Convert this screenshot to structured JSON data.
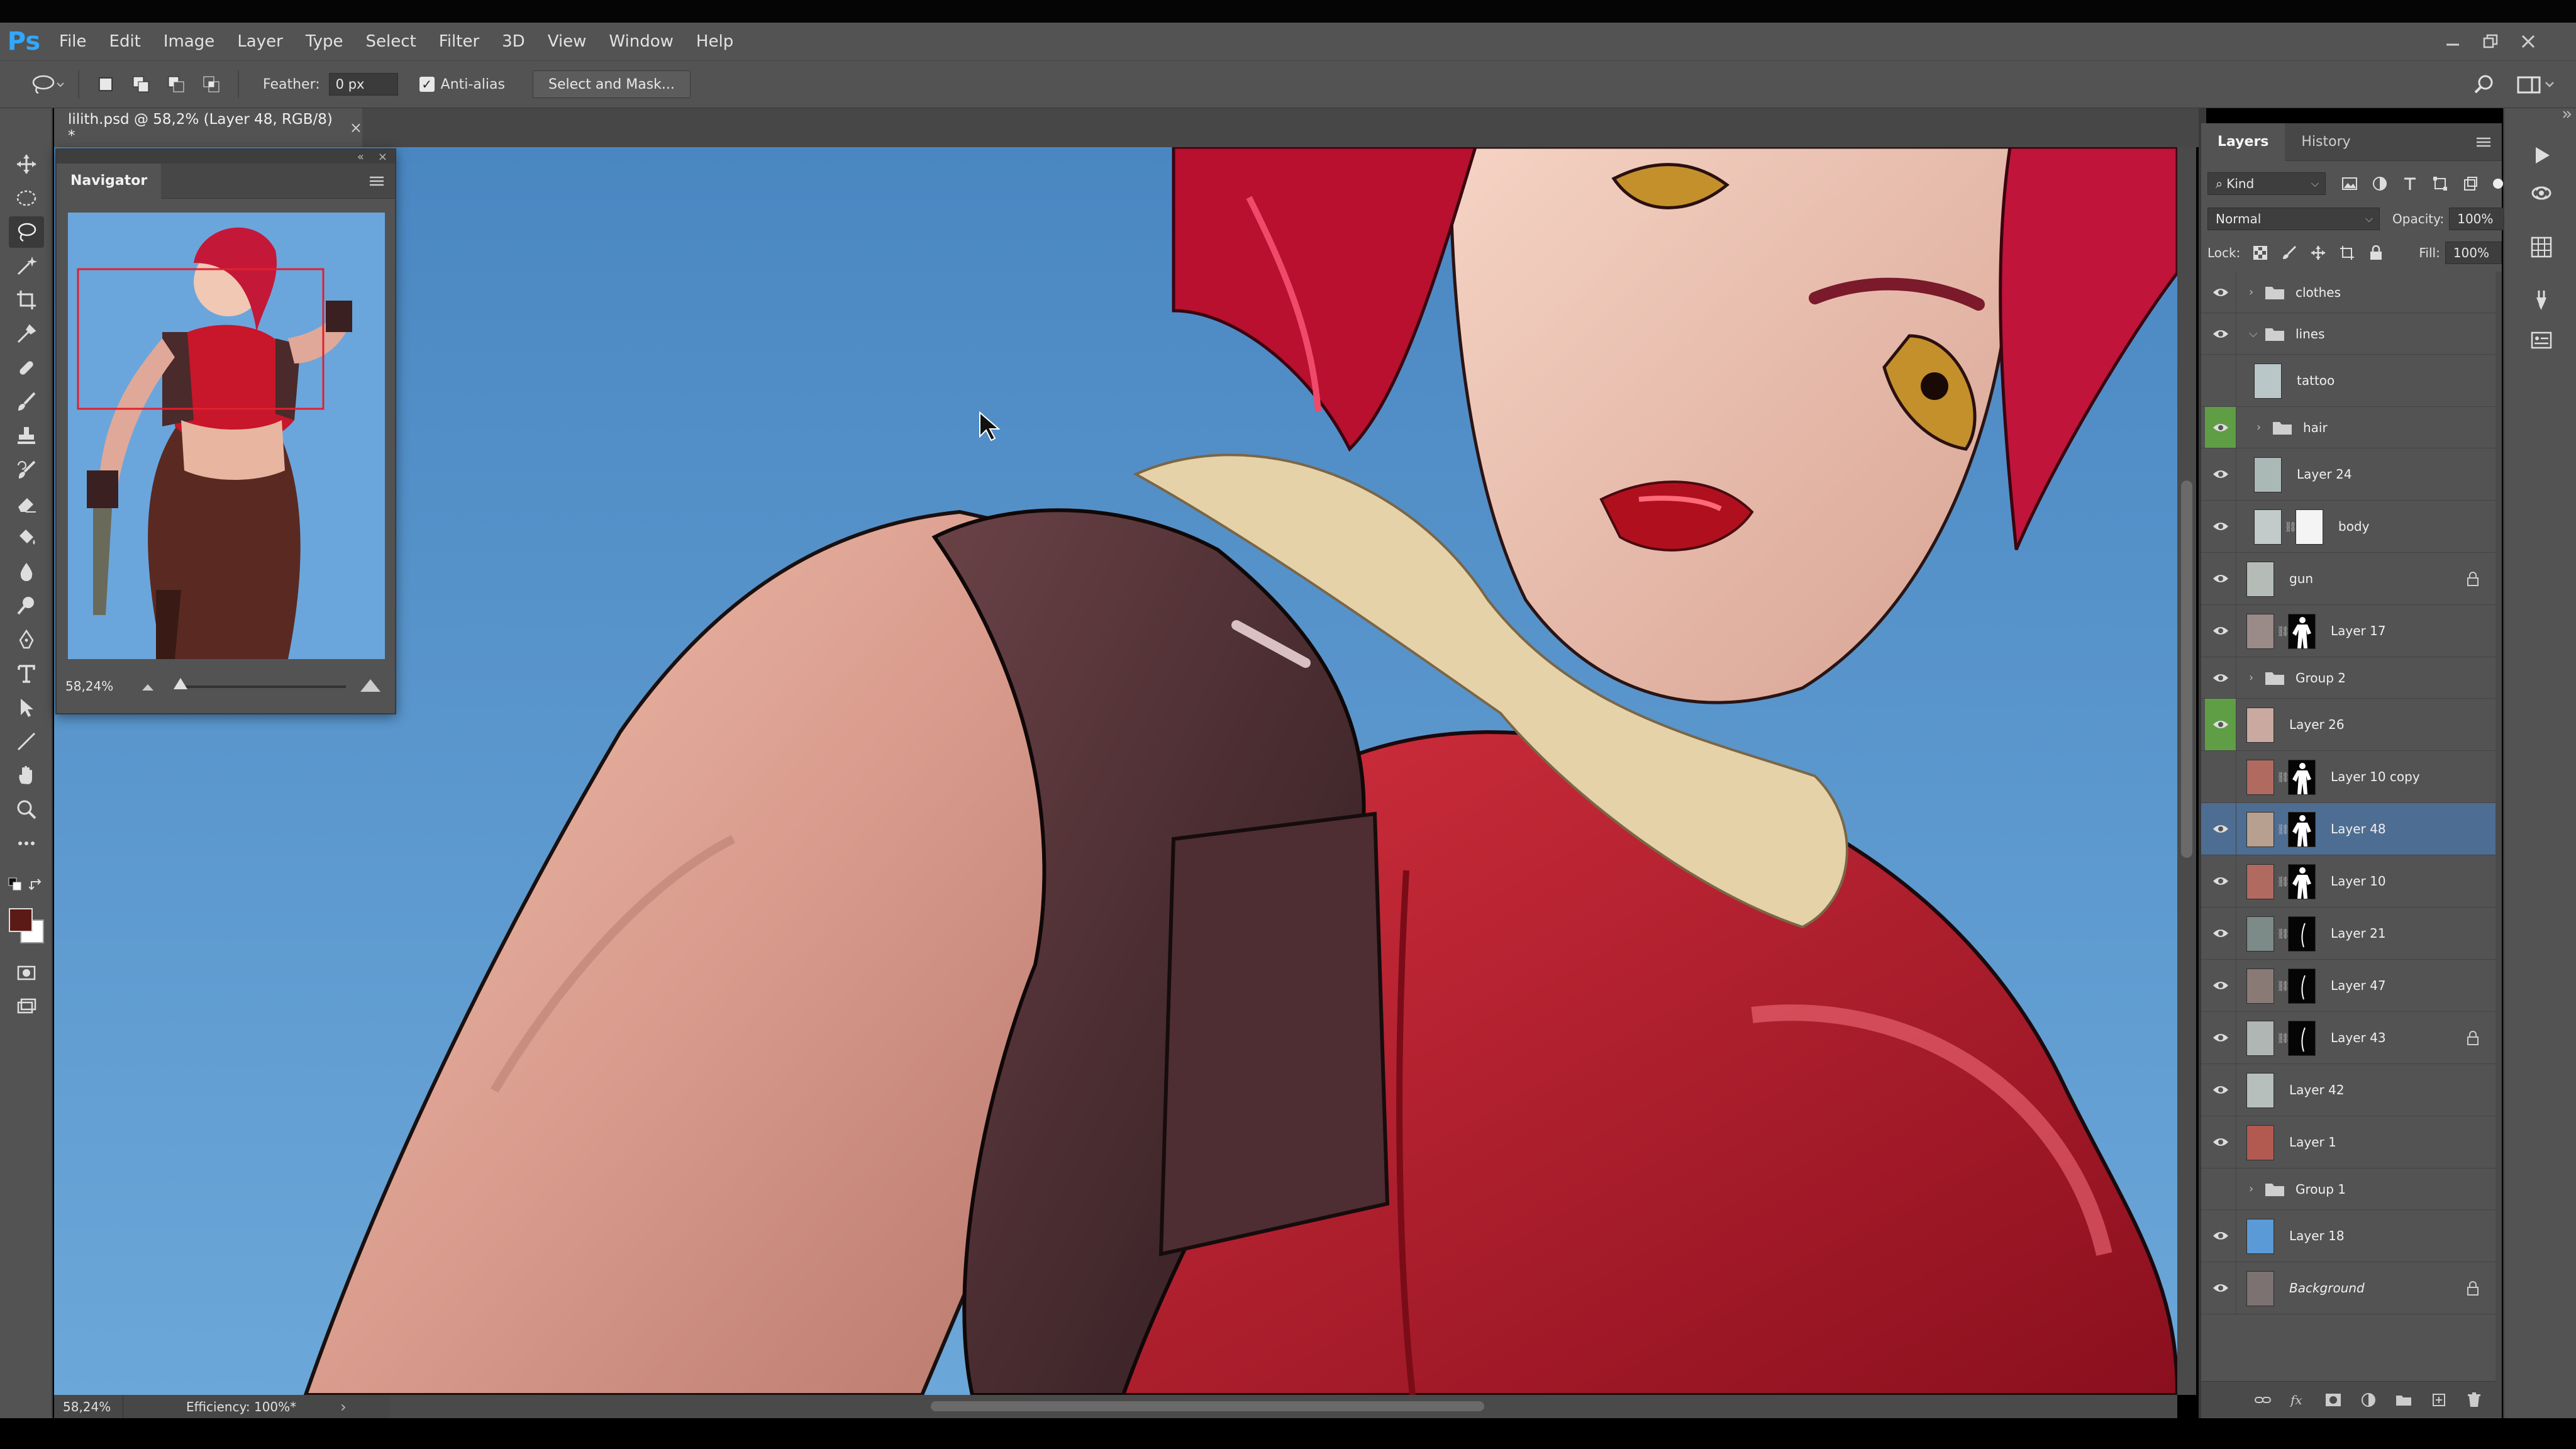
{
  "app": {
    "logo": "Ps"
  },
  "menu": [
    "File",
    "Edit",
    "Image",
    "Layer",
    "Type",
    "Select",
    "Filter",
    "3D",
    "View",
    "Window",
    "Help"
  ],
  "options": {
    "feather_label": "Feather:",
    "feather_value": "0 px",
    "antialias_label": "Anti-alias",
    "antialias_checked": "✓",
    "select_mask_label": "Select and Mask..."
  },
  "document": {
    "tab_title": "lilith.psd @ 58,2% (Layer 48, RGB/8) *",
    "close": "×"
  },
  "status": {
    "zoom": "58,24%",
    "efficiency": "Efficiency: 100%*",
    "arrow": "›"
  },
  "navigator": {
    "title": "Navigator",
    "zoom": "58,24%",
    "collapse": "«",
    "close": "×"
  },
  "layers_panel": {
    "tabs": [
      "Layers",
      "History"
    ],
    "filter_kind": "Kind",
    "filter_icon": "⌕",
    "blend_mode": "Normal",
    "opacity_label": "Opacity:",
    "opacity_value": "100%",
    "lock_label": "Lock:",
    "fill_label": "Fill:",
    "fill_value": "100%",
    "layers": [
      {
        "name": "clothes",
        "type": "group",
        "expanded": false,
        "visible": true
      },
      {
        "name": "lines",
        "type": "group",
        "expanded": true,
        "visible": true
      },
      {
        "name": "tattoo",
        "type": "layer",
        "visible": false,
        "indent": true
      },
      {
        "name": "hair",
        "type": "group",
        "expanded": false,
        "visible": true,
        "indent": true,
        "eye_highlight": true
      },
      {
        "name": "Layer 24",
        "type": "layer",
        "visible": true,
        "indent": true
      },
      {
        "name": "body",
        "type": "layer",
        "visible": true,
        "indent": true,
        "mask": "white"
      },
      {
        "name": "gun",
        "type": "layer",
        "visible": true,
        "locked": true
      },
      {
        "name": "Layer 17",
        "type": "layer",
        "visible": true,
        "mask": "figure"
      },
      {
        "name": "Group 2",
        "type": "group",
        "expanded": false,
        "visible": true
      },
      {
        "name": "Layer 26",
        "type": "layer",
        "visible": true,
        "eye_highlight": true
      },
      {
        "name": "Layer 10 copy",
        "type": "layer",
        "visible": false,
        "mask": "figure"
      },
      {
        "name": "Layer 48",
        "type": "layer",
        "visible": true,
        "mask": "figure",
        "selected": true
      },
      {
        "name": "Layer 10",
        "type": "layer",
        "visible": true,
        "mask": "figure"
      },
      {
        "name": "Layer 21",
        "type": "layer",
        "visible": true,
        "mask": "black"
      },
      {
        "name": "Layer 47",
        "type": "layer",
        "visible": true,
        "mask": "black"
      },
      {
        "name": "Layer 43",
        "type": "layer",
        "visible": true,
        "mask": "black",
        "locked": true
      },
      {
        "name": "Layer 42",
        "type": "layer",
        "visible": true
      },
      {
        "name": "Layer 1",
        "type": "layer",
        "visible": true
      },
      {
        "name": "Group 1",
        "type": "group",
        "expanded": false,
        "visible": false
      },
      {
        "name": "Layer 18",
        "type": "layer",
        "visible": true
      },
      {
        "name": "Background",
        "type": "layer",
        "visible": true,
        "locked": true,
        "italic": true
      }
    ]
  },
  "colors": {
    "foreground": "#5c1a16",
    "background": "#ffffff",
    "canvas_bg": "#4b8bc4",
    "selected_layer": "#4e6d92",
    "eye_highlight": "#5f9e45"
  }
}
